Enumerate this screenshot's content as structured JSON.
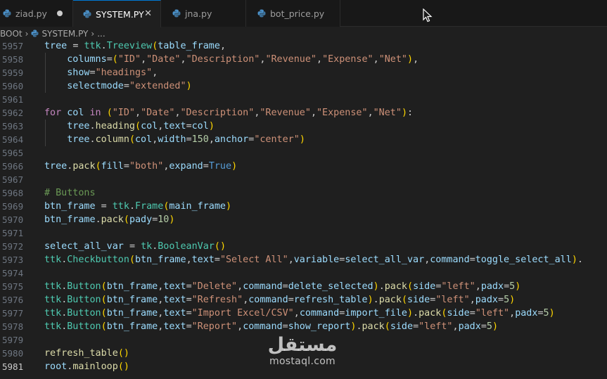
{
  "tabs": [
    {
      "label": "ziad.py",
      "state": "modified"
    },
    {
      "label": "SYSTEM.PY",
      "state": "active"
    },
    {
      "label": "jna.py",
      "state": "normal"
    },
    {
      "label": "bot_price.py",
      "state": "normal"
    }
  ],
  "breadcrumb": {
    "folder": "BOOt",
    "file": "SYSTEM.PY",
    "more": "..."
  },
  "colors": {
    "editor_bg": "#1f1f1f",
    "python_icon": "#4a90c8",
    "accent": "#0078d4"
  },
  "editor": {
    "current_line": "5981",
    "lines": [
      {
        "n": "5957",
        "code": "tree = ttk.Treeview(table_frame,"
      },
      {
        "n": "5958",
        "code": "    columns=(\"ID\",\"Date\",\"Description\",\"Revenue\",\"Expense\",\"Net\"),"
      },
      {
        "n": "5959",
        "code": "    show=\"headings\","
      },
      {
        "n": "5960",
        "code": "    selectmode=\"extended\")"
      },
      {
        "n": "5961",
        "code": ""
      },
      {
        "n": "5962",
        "code": "for col in (\"ID\",\"Date\",\"Description\",\"Revenue\",\"Expense\",\"Net\"):"
      },
      {
        "n": "5963",
        "code": "    tree.heading(col,text=col)"
      },
      {
        "n": "5964",
        "code": "    tree.column(col,width=150,anchor=\"center\")"
      },
      {
        "n": "5965",
        "code": ""
      },
      {
        "n": "5966",
        "code": "tree.pack(fill=\"both\",expand=True)"
      },
      {
        "n": "5967",
        "code": ""
      },
      {
        "n": "5968",
        "code": "# Buttons"
      },
      {
        "n": "5969",
        "code": "btn_frame = ttk.Frame(main_frame)"
      },
      {
        "n": "5970",
        "code": "btn_frame.pack(pady=10)"
      },
      {
        "n": "5971",
        "code": ""
      },
      {
        "n": "5972",
        "code": "select_all_var = tk.BooleanVar()"
      },
      {
        "n": "5973",
        "code": "ttk.Checkbutton(btn_frame,text=\"Select All\",variable=select_all_var,command=toggle_select_all)."
      },
      {
        "n": "5974",
        "code": ""
      },
      {
        "n": "5975",
        "code": "ttk.Button(btn_frame,text=\"Delete\",command=delete_selected).pack(side=\"left\",padx=5)"
      },
      {
        "n": "5976",
        "code": "ttk.Button(btn_frame,text=\"Refresh\",command=refresh_table).pack(side=\"left\",padx=5)"
      },
      {
        "n": "5977",
        "code": "ttk.Button(btn_frame,text=\"Import Excel/CSV\",command=import_file).pack(side=\"left\",padx=5)"
      },
      {
        "n": "5978",
        "code": "ttk.Button(btn_frame,text=\"Report\",command=show_report).pack(side=\"left\",padx=5)"
      },
      {
        "n": "5979",
        "code": ""
      },
      {
        "n": "5980",
        "code": "refresh_table()"
      },
      {
        "n": "5981",
        "code": "root.mainloop()"
      }
    ]
  },
  "watermark": {
    "arabic": "مستقل",
    "latin": "mostaql.com"
  }
}
